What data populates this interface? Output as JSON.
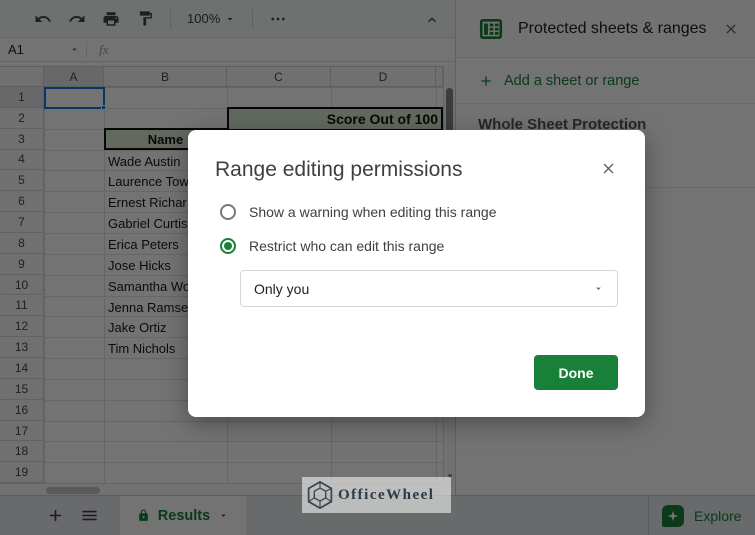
{
  "toolbar": {
    "zoom_value": "100%"
  },
  "name_box": {
    "value": "A1",
    "fx_label": "fx"
  },
  "grid": {
    "columns": [
      "A",
      "B",
      "C",
      "D"
    ],
    "rows": [
      "1",
      "2",
      "3",
      "4",
      "5",
      "6",
      "7",
      "8",
      "9",
      "10",
      "11",
      "12",
      "13",
      "14",
      "15",
      "16",
      "17",
      "18",
      "19"
    ],
    "selected_cell": "A1",
    "name_header": "Name",
    "score_header": "Score Out of 100",
    "names_start_row": 4,
    "names": [
      "Wade Austin",
      "Laurence Tow",
      "Ernest Richar",
      "Gabriel Curtis",
      "Erica Peters",
      "Jose Hicks",
      "Samantha Wo",
      "Jenna Ramse",
      "Jake Ortiz",
      "Tim Nichols"
    ]
  },
  "sidebar": {
    "title": "Protected sheets & ranges",
    "add_label": "Add a sheet or range",
    "item_label": "Whole Sheet Protection"
  },
  "modal": {
    "title": "Range editing permissions",
    "option_warning": "Show a warning when editing this range",
    "option_restrict": "Restrict who can edit this range",
    "selected_option": "restrict",
    "dropdown_value": "Only you",
    "done_label": "Done"
  },
  "bottom_bar": {
    "active_tab": "Results",
    "explore_label": "Explore"
  },
  "watermark": {
    "text": "OfficeWheel"
  },
  "colors": {
    "accent_green": "#188038",
    "selection_blue": "#1a73e8",
    "cell_fill_green": "#d9ead3"
  }
}
